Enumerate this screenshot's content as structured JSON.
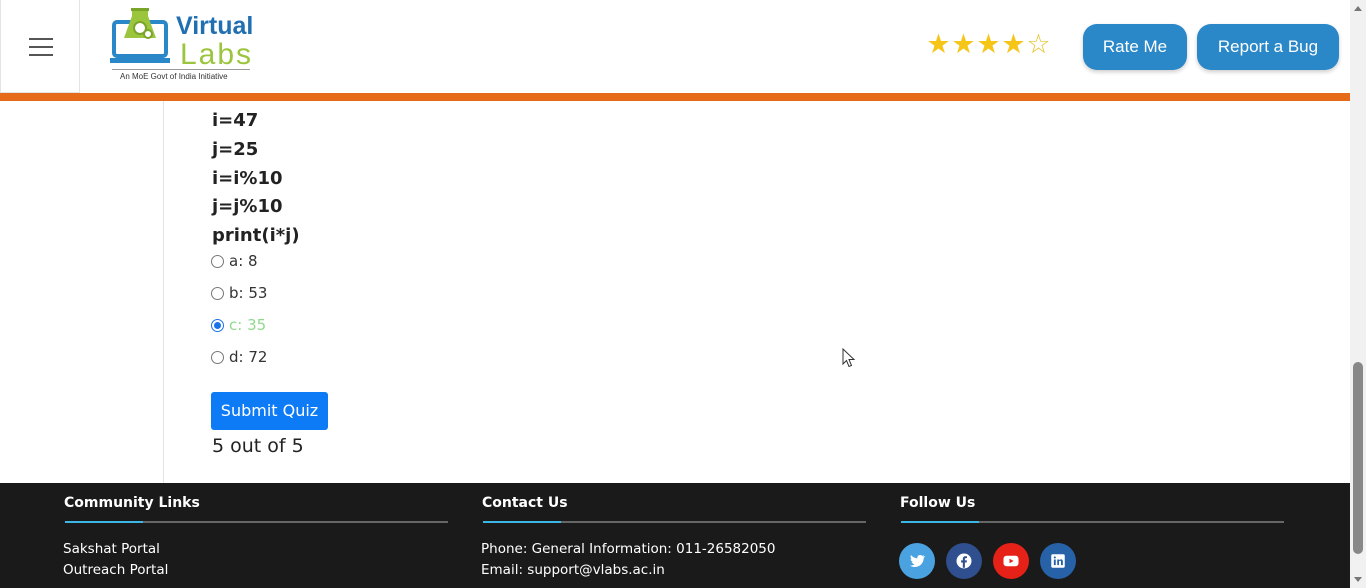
{
  "header": {
    "logo": {
      "title": "Virtual",
      "subtitle": "Labs",
      "tagline": "An MoE Govt of India Initiative"
    },
    "rating": {
      "value": 4,
      "max": 5
    },
    "rate_label": "Rate Me",
    "bug_label": "Report a Bug"
  },
  "quiz": {
    "code_lines": [
      "i=47",
      "j=25",
      "i=i%10",
      "j=j%10",
      "print(i*j)"
    ],
    "options": [
      {
        "label": "a: 8",
        "checked": false,
        "correct": false
      },
      {
        "label": "b: 53",
        "checked": false,
        "correct": false
      },
      {
        "label": "c: 35",
        "checked": true,
        "correct": true
      },
      {
        "label": "d: 72",
        "checked": false,
        "correct": false
      }
    ],
    "submit_label": "Submit Quiz",
    "score": "5 out of 5"
  },
  "footer": {
    "community": {
      "title": "Community Links",
      "links": [
        "Sakshat Portal",
        "Outreach Portal"
      ]
    },
    "contact": {
      "title": "Contact Us",
      "phone": "Phone: General Information: 011-26582050",
      "email": "Email: support@vlabs.ac.in"
    },
    "follow": {
      "title": "Follow Us",
      "icons": [
        "twitter-icon",
        "facebook-icon",
        "youtube-icon",
        "linkedin-icon"
      ]
    }
  },
  "colors": {
    "accent": "#e56a19",
    "primary_button": "#0d7bf5",
    "pill_button": "#2a87c8",
    "correct": "#8fd98f"
  }
}
